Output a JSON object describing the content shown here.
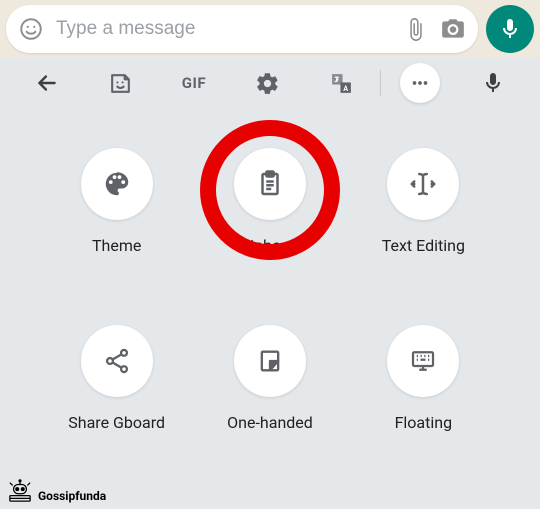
{
  "colors": {
    "accent": "#00897b",
    "highlight": "#e60000",
    "panel_bg": "#e5e8eb",
    "icon": "#5f6368"
  },
  "message_bar": {
    "placeholder": "Type a message"
  },
  "toolbar": {
    "gif_label": "GIF"
  },
  "grid": {
    "items": [
      {
        "label": "Theme"
      },
      {
        "label": "Clipboard"
      },
      {
        "label": "Text Editing"
      },
      {
        "label": "Share Gboard"
      },
      {
        "label": "One-handed"
      },
      {
        "label": "Floating"
      }
    ]
  },
  "watermark": {
    "text": "Gossipfunda"
  }
}
